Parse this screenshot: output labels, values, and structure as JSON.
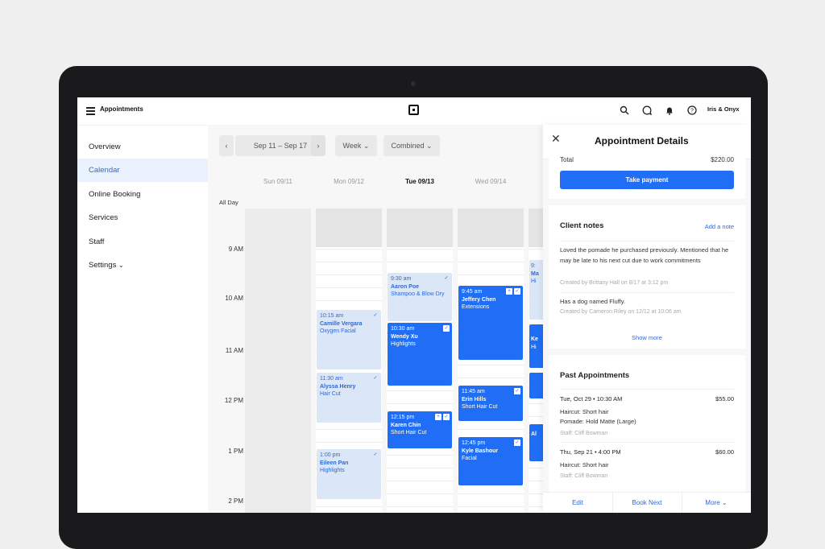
{
  "header": {
    "app_title": "Appointments",
    "user": "Iris & Onyx",
    "icons": [
      "menu-icon",
      "square-logo",
      "search-icon",
      "chat-icon",
      "bell-icon",
      "help-icon"
    ]
  },
  "sidebar": {
    "items": [
      {
        "label": "Overview"
      },
      {
        "label": "Calendar"
      },
      {
        "label": "Online Booking"
      },
      {
        "label": "Services"
      },
      {
        "label": "Staff"
      },
      {
        "label": "Settings"
      }
    ]
  },
  "toolbar": {
    "prev": "‹",
    "range": "Sep 11 – Sep 17",
    "next": "›",
    "view": "Week",
    "filter": "Combined"
  },
  "calendar": {
    "days": [
      "Sun 09/11",
      "Mon 09/12",
      "Tue 09/13",
      "Wed 09/14"
    ],
    "all_day": "All Day",
    "times": [
      "9 AM",
      "10 AM",
      "11 AM",
      "12 PM",
      "1 PM",
      "2 PM"
    ],
    "appointments": [
      {
        "time": "10:15 am",
        "name": "Camille Vergara",
        "service": "Oxygen Facial"
      },
      {
        "time": "11:30 am",
        "name": "Alyssa Henry",
        "service": "Hair Cut"
      },
      {
        "time": "1:00 pm",
        "name": "Eileen Pan",
        "service": "Highlights"
      },
      {
        "time": "9:30 am",
        "name": "Aaron Poe",
        "service": "Shampoo & Blow Dry"
      },
      {
        "time": "10:30 am",
        "name": "Wendy Xu",
        "service": "Highlights"
      },
      {
        "time": "12:15 pm",
        "name": "Karen Chin",
        "service": "Short Hair Cut"
      },
      {
        "time": "9:45 am",
        "name": "Jeffery Chen",
        "service": "Extensions"
      },
      {
        "time": "11:45 am",
        "name": "Erin Hills",
        "service": "Short Hair Cut"
      },
      {
        "time": "12:45 pm",
        "name": "Kyle Bashour",
        "service": "Facial"
      }
    ],
    "partial": {
      "a": "9:",
      "b": "Ma",
      "c": "Hi",
      "d": "Ke",
      "e": "Hi",
      "f": "Al"
    }
  },
  "panel": {
    "title": "Appointment Details",
    "total_label": "Total",
    "total_value": "$220.00",
    "take_payment": "Take payment",
    "client_notes_title": "Client notes",
    "add_note": "Add a note",
    "notes": [
      {
        "text": "Loved the pomade he purchased previously. Mentioned that he may be late to his next cut due to work commitments",
        "meta": "Created by Brittany Hall on 8/17 at 3:12 pm"
      },
      {
        "text": "Has a dog named Fluffy.",
        "meta": "Created by Cameron Riley on 12/12 at 10:06 am"
      }
    ],
    "show_more": "Show more",
    "past_title": "Past Appointments",
    "past": [
      {
        "date": "Tue, Oct 29  •  10:30 AM",
        "price": "$55.00",
        "lines": [
          "Haircut: Short hair",
          "Pomade: Hold Matte (Large)"
        ],
        "staff": "Staff: Cliff Bowman"
      },
      {
        "date": "Thu, Sep 21  •  4:00 PM",
        "price": "$60.00",
        "lines": [
          "Haircut: Short hair"
        ],
        "staff": "Staff: Cliff Bowman"
      }
    ],
    "footer": {
      "edit": "Edit",
      "book_next": "Book Next",
      "more": "More ⌄"
    }
  },
  "colors": {
    "accent": "#1f6ef5",
    "selected_bg": "#e9f1fc",
    "light_appt": "#dbe6f7"
  }
}
